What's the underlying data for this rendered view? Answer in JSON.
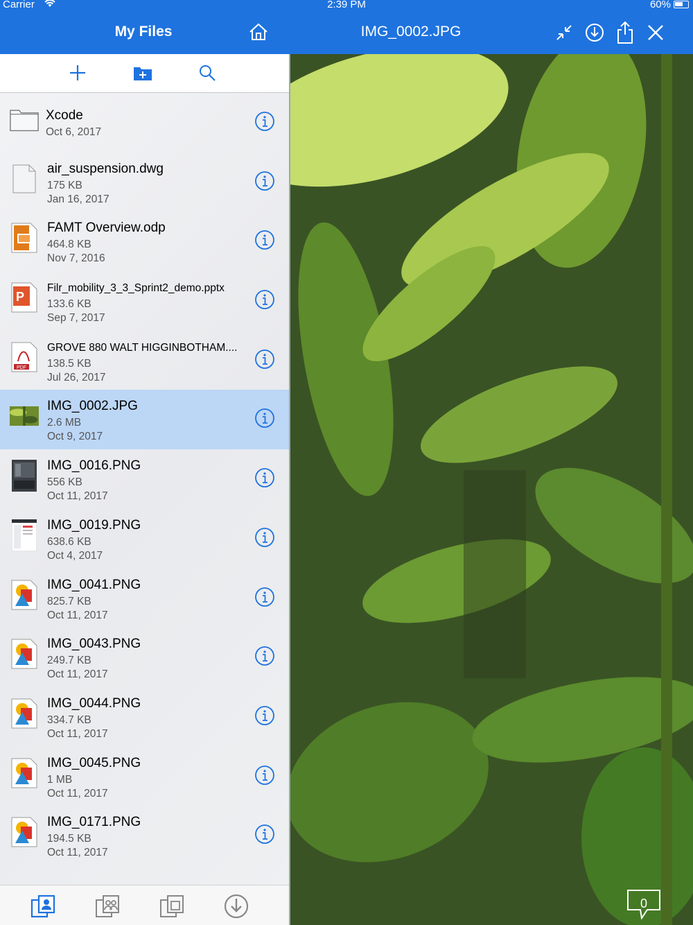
{
  "status_bar": {
    "carrier": "Carrier",
    "time": "2:39 PM",
    "battery": "60%"
  },
  "nav": {
    "title": "My Files"
  },
  "preview": {
    "title": "IMG_0002.JPG",
    "comment_count": "0"
  },
  "files": [
    {
      "name": "Xcode",
      "line1": "Oct 6, 2017",
      "line2": "",
      "type": "folder"
    },
    {
      "name": "air_suspension.dwg",
      "line1": "175 KB",
      "line2": "Jan 16, 2017",
      "type": "generic"
    },
    {
      "name": "FAMT Overview.odp",
      "line1": "464.8 KB",
      "line2": "Nov 7, 2016",
      "type": "odp"
    },
    {
      "name": "Filr_mobility_3_3_Sprint2_demo.pptx",
      "line1": "133.6 KB",
      "line2": "Sep 7, 2017",
      "type": "pptx"
    },
    {
      "name": "GROVE 880 WALT HIGGINBOTHAM....",
      "line1": "138.5 KB",
      "line2": "Jul 26, 2017",
      "type": "pdf"
    },
    {
      "name": "IMG_0002.JPG",
      "line1": "2.6 MB",
      "line2": "Oct 9, 2017",
      "type": "photo"
    },
    {
      "name": "IMG_0016.PNG",
      "line1": "556 KB",
      "line2": "Oct 11, 2017",
      "type": "screen-dark"
    },
    {
      "name": "IMG_0019.PNG",
      "line1": "638.6 KB",
      "line2": "Oct 4, 2017",
      "type": "screen-light"
    },
    {
      "name": "IMG_0041.PNG",
      "line1": "825.7 KB",
      "line2": "Oct 11, 2017",
      "type": "image"
    },
    {
      "name": "IMG_0043.PNG",
      "line1": "249.7 KB",
      "line2": "Oct 11, 2017",
      "type": "image"
    },
    {
      "name": "IMG_0044.PNG",
      "line1": "334.7 KB",
      "line2": "Oct 11, 2017",
      "type": "image"
    },
    {
      "name": "IMG_0045.PNG",
      "line1": "1 MB",
      "line2": "Oct 11, 2017",
      "type": "image"
    },
    {
      "name": "IMG_0171.PNG",
      "line1": "194.5 KB",
      "line2": "Oct 11, 2017",
      "type": "image"
    }
  ],
  "colors": {
    "accent": "#1e73df",
    "selected_row": "#bcd6f6"
  }
}
